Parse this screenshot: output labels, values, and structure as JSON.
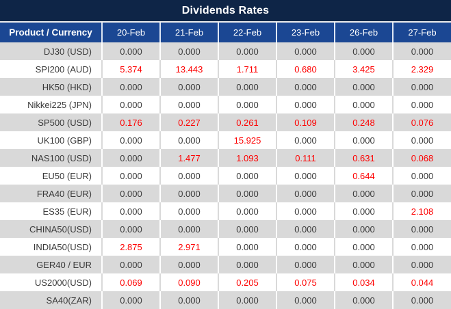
{
  "colors": {
    "title_bg": "#0e2547",
    "header_bg": "#1b4793",
    "header_text": "#ffffff",
    "stripe": "#d9d9d9",
    "row_white": "#ffffff",
    "value_text": "#3a3a3a",
    "highlight_red": "#fe0000"
  },
  "chart_data": {
    "type": "table",
    "title": "Dividends Rates",
    "columns": [
      "Product / Currency",
      "20-Feb",
      "21-Feb",
      "22-Feb",
      "23-Feb",
      "26-Feb",
      "27-Feb"
    ],
    "rows": [
      {
        "product": "DJ30 (USD)",
        "values": [
          "0.000",
          "0.000",
          "0.000",
          "0.000",
          "0.000",
          "0.000"
        ],
        "red": [
          false,
          false,
          false,
          false,
          false,
          false
        ]
      },
      {
        "product": "SPI200 (AUD)",
        "values": [
          "5.374",
          "13.443",
          "1.711",
          "0.680",
          "3.425",
          "2.329"
        ],
        "red": [
          true,
          true,
          true,
          true,
          true,
          true
        ]
      },
      {
        "product": "HK50 (HKD)",
        "values": [
          "0.000",
          "0.000",
          "0.000",
          "0.000",
          "0.000",
          "0.000"
        ],
        "red": [
          false,
          false,
          false,
          false,
          false,
          false
        ]
      },
      {
        "product": "Nikkei225 (JPN)",
        "values": [
          "0.000",
          "0.000",
          "0.000",
          "0.000",
          "0.000",
          "0.000"
        ],
        "red": [
          false,
          false,
          false,
          false,
          false,
          false
        ]
      },
      {
        "product": "SP500 (USD)",
        "values": [
          "0.176",
          "0.227",
          "0.261",
          "0.109",
          "0.248",
          "0.076"
        ],
        "red": [
          true,
          true,
          true,
          true,
          true,
          true
        ]
      },
      {
        "product": "UK100 (GBP)",
        "values": [
          "0.000",
          "0.000",
          "15.925",
          "0.000",
          "0.000",
          "0.000"
        ],
        "red": [
          false,
          false,
          true,
          false,
          false,
          false
        ]
      },
      {
        "product": "NAS100 (USD)",
        "values": [
          "0.000",
          "1.477",
          "1.093",
          "0.111",
          "0.631",
          "0.068"
        ],
        "red": [
          false,
          true,
          true,
          true,
          true,
          true
        ]
      },
      {
        "product": "EU50 (EUR)",
        "values": [
          "0.000",
          "0.000",
          "0.000",
          "0.000",
          "0.644",
          "0.000"
        ],
        "red": [
          false,
          false,
          false,
          false,
          true,
          false
        ]
      },
      {
        "product": "FRA40 (EUR)",
        "values": [
          "0.000",
          "0.000",
          "0.000",
          "0.000",
          "0.000",
          "0.000"
        ],
        "red": [
          false,
          false,
          false,
          false,
          false,
          false
        ]
      },
      {
        "product": "ES35 (EUR)",
        "values": [
          "0.000",
          "0.000",
          "0.000",
          "0.000",
          "0.000",
          "2.108"
        ],
        "red": [
          false,
          false,
          false,
          false,
          false,
          true
        ]
      },
      {
        "product": "CHINA50(USD)",
        "values": [
          "0.000",
          "0.000",
          "0.000",
          "0.000",
          "0.000",
          "0.000"
        ],
        "red": [
          false,
          false,
          false,
          false,
          false,
          false
        ]
      },
      {
        "product": "INDIA50(USD)",
        "values": [
          "2.875",
          "2.971",
          "0.000",
          "0.000",
          "0.000",
          "0.000"
        ],
        "red": [
          true,
          true,
          false,
          false,
          false,
          false
        ]
      },
      {
        "product": "GER40 / EUR",
        "values": [
          "0.000",
          "0.000",
          "0.000",
          "0.000",
          "0.000",
          "0.000"
        ],
        "red": [
          false,
          false,
          false,
          false,
          false,
          false
        ]
      },
      {
        "product": "US2000(USD)",
        "values": [
          "0.069",
          "0.090",
          "0.205",
          "0.075",
          "0.034",
          "0.044"
        ],
        "red": [
          true,
          true,
          true,
          true,
          true,
          true
        ]
      },
      {
        "product": "SA40(ZAR)",
        "values": [
          "0.000",
          "0.000",
          "0.000",
          "0.000",
          "0.000",
          "0.000"
        ],
        "red": [
          false,
          false,
          false,
          false,
          false,
          false
        ]
      }
    ]
  }
}
